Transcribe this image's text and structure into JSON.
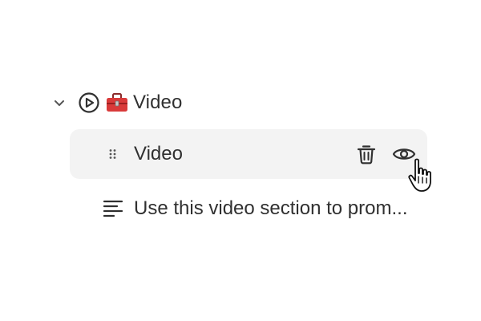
{
  "section": {
    "label": "Video",
    "icons": {
      "collapse": "chevron-down-icon",
      "type": "play-circle-icon",
      "emoji": "toolbox-icon"
    }
  },
  "block": {
    "label": "Video",
    "icons": {
      "drag": "drag-handle-icon",
      "delete": "trash-icon",
      "visibility": "eye-icon"
    }
  },
  "setting": {
    "label": "Use this video section to prom...",
    "icon": "text-align-left-icon"
  },
  "colors": {
    "text": "#303030",
    "row_highlight": "#f3f3f3",
    "toolbox_red": "#d93a3a"
  }
}
